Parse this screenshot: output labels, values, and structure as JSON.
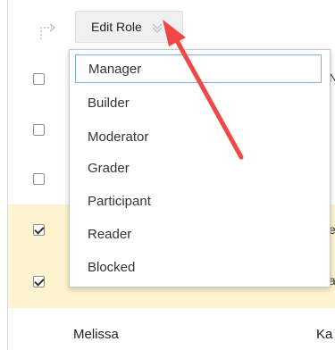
{
  "toolbar": {
    "edit_role_label": "Edit Role"
  },
  "menu": {
    "items": [
      {
        "label": "Manager",
        "focused": true
      },
      {
        "label": "Builder"
      },
      {
        "label": "Moderator"
      },
      {
        "label": "Grader"
      },
      {
        "label": "Participant"
      },
      {
        "label": "Reader"
      },
      {
        "label": "Blocked"
      }
    ]
  },
  "rows": [
    {
      "checked": false,
      "edge": "N"
    },
    {
      "checked": false,
      "edge": ""
    },
    {
      "checked": false,
      "edge": ""
    },
    {
      "checked": true,
      "edge": "e",
      "highlight": true
    },
    {
      "checked": true,
      "edge": "a",
      "highlight": true
    }
  ],
  "bottom_row": {
    "name": "Melissa",
    "right_text": "Ka"
  },
  "icons": {
    "tree": "tree-branch-icon",
    "chevron": "chevron-down-icon",
    "annotation": "red-arrow-annotation"
  },
  "colors": {
    "highlight_row": "#fdf3cf",
    "focus_border": "#7fb0e6",
    "arrow": "#f04747"
  }
}
